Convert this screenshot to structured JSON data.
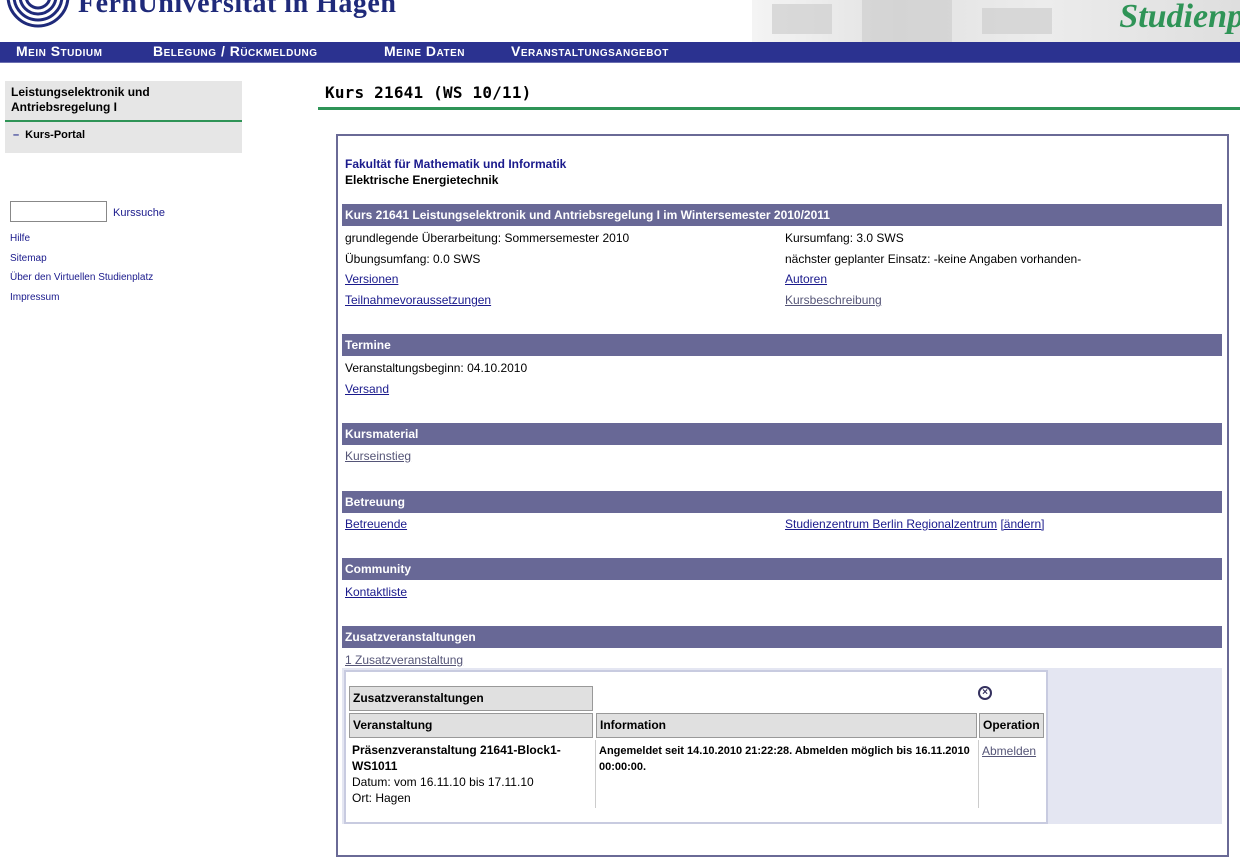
{
  "header": {
    "university": "FernUniversität in Hagen",
    "brand": "Studienp",
    "brand_color": "#2f9457",
    "nav_color": "#2b3290"
  },
  "nav": [
    "Mein Studium",
    "Belegung / Rückmeldung",
    "Meine Daten",
    "Veranstaltungsangebot"
  ],
  "sidebar": {
    "course_title": "Leistungselektronik und Antriebsregelung I",
    "portal_label": "Kurs-Portal",
    "search_value": "",
    "search_link": "Kurssuche",
    "links": [
      "Hilfe",
      "Sitemap",
      "Über den Virtuellen Studienplatz",
      "Impressum"
    ]
  },
  "page_title": "Kurs 21641 (WS 10/11)",
  "main": {
    "faculty": "Fakultät für Mathematik und Informatik",
    "subject": "Elektrische Energietechnik",
    "course_section": {
      "header": "Kurs 21641 Leistungselektronik und Antriebsregelung I im Wintersemester 2010/2011",
      "revision": "grundlegende Überarbeitung: Sommersemester 2010",
      "scope": "Kursumfang: 3.0 SWS",
      "exercise": "Übungsumfang: 0.0 SWS",
      "next_use": "nächster geplanter Einsatz: -keine Angaben vorhanden-",
      "link_versions": "Versionen",
      "link_authors": "Autoren",
      "link_prereq": "Teilnahmevoraussetzungen",
      "link_description": "Kursbeschreibung"
    },
    "termine": {
      "header": "Termine",
      "start": "Veranstaltungsbeginn: 04.10.2010",
      "link_versand": "Versand"
    },
    "material": {
      "header": "Kursmaterial",
      "link": "Kurseinstieg"
    },
    "betreuung": {
      "header": "Betreuung",
      "link_betreuende": "Betreuende",
      "center": "Studienzentrum Berlin Regionalzentrum",
      "change": "[ändern]"
    },
    "community": {
      "header": "Community",
      "link": "Kontaktliste"
    },
    "zusatz": {
      "header": "Zusatzveranstaltungen",
      "link": "1 Zusatzveranstaltung",
      "table_title": "Zusatzveranstaltungen",
      "col_event": "Veranstaltung",
      "col_info": "Information",
      "col_op": "Operation",
      "row": {
        "event_name": "Präsenzveranstaltung 21641-Block1-WS1011",
        "date": "Datum: vom 16.11.10 bis 17.11.10",
        "place": "Ort: Hagen",
        "info": "Angemeldet seit 14.10.2010 21:22:28. Abmelden möglich bis 16.11.2010 00:00:00.",
        "op": "Abmelden"
      }
    }
  }
}
